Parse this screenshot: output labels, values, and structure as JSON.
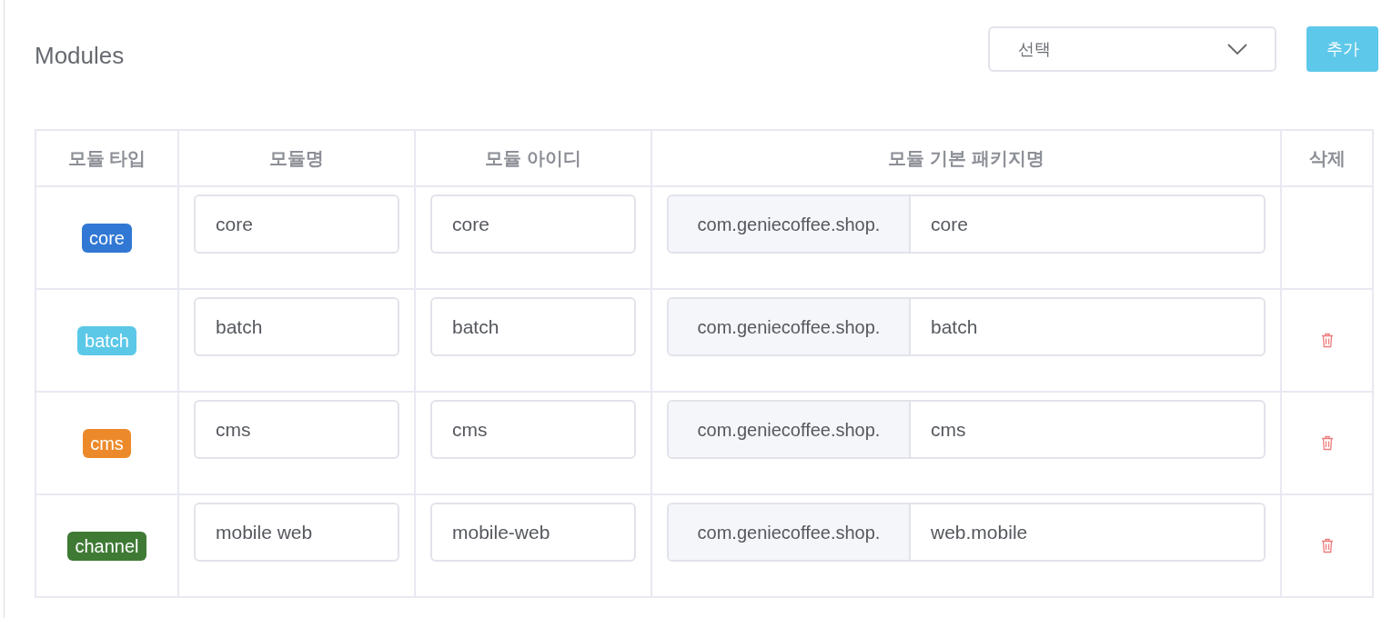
{
  "title": "Modules",
  "select": {
    "placeholder": "선택"
  },
  "add_button": "추가",
  "table": {
    "columns": [
      "모듈 타입",
      "모듈명",
      "모듈 아이디",
      "모듈 기본 패키지명",
      "삭제"
    ],
    "rows": [
      {
        "type": "core",
        "color": "#3178d4",
        "name": "core",
        "id": "core",
        "package_prefix": "com.geniecoffee.shop.",
        "package": "core",
        "deletable": false
      },
      {
        "type": "batch",
        "color": "#5bc8e8",
        "name": "batch",
        "id": "batch",
        "package_prefix": "com.geniecoffee.shop.",
        "package": "batch",
        "deletable": true
      },
      {
        "type": "cms",
        "color": "#ec8a2b",
        "name": "cms",
        "id": "cms",
        "package_prefix": "com.geniecoffee.shop.",
        "package": "cms",
        "deletable": true
      },
      {
        "type": "channel",
        "color": "#3f7a34",
        "name": "mobile web",
        "id": "mobile-web",
        "package_prefix": "com.geniecoffee.shop.",
        "package": "web.mobile",
        "deletable": true
      }
    ]
  }
}
